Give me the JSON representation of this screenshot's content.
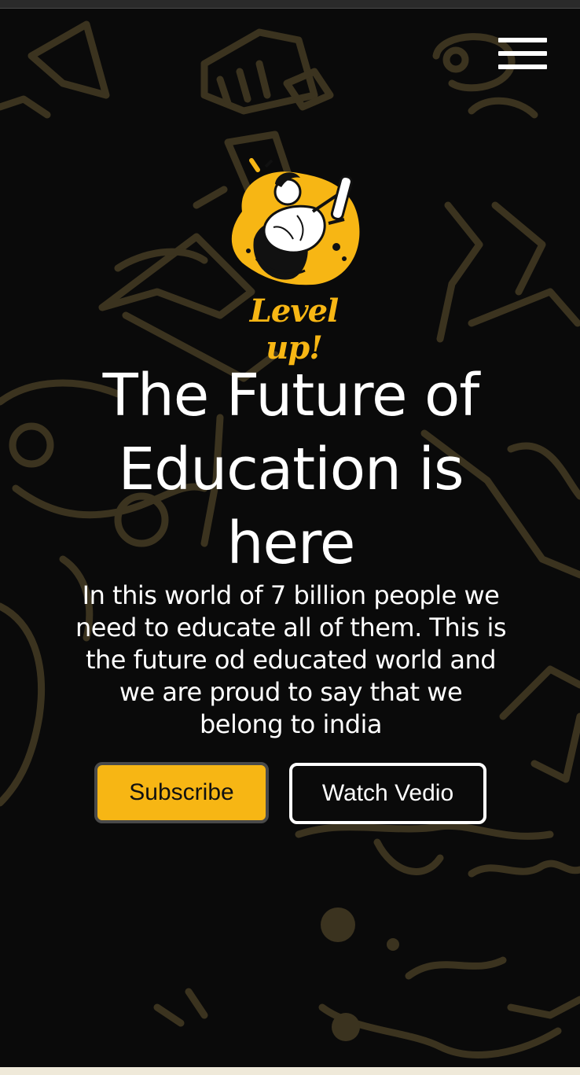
{
  "nav": {
    "menu_icon": "hamburger-menu-icon"
  },
  "logo": {
    "text": "Level up!",
    "illustration": "person-reading-scroll-illustration"
  },
  "hero": {
    "title": "The Future of Education is here",
    "text": "In this world of 7 billion people we need to educate all of them. This is the future od educated world and we are proud to say that we belong to india"
  },
  "buttons": {
    "subscribe": "Subscribe",
    "watch": "Watch Vedio"
  },
  "colors": {
    "accent": "#f7b614",
    "background": "#0a0a0a",
    "doodle": "#3a3220",
    "text": "#ffffff"
  }
}
